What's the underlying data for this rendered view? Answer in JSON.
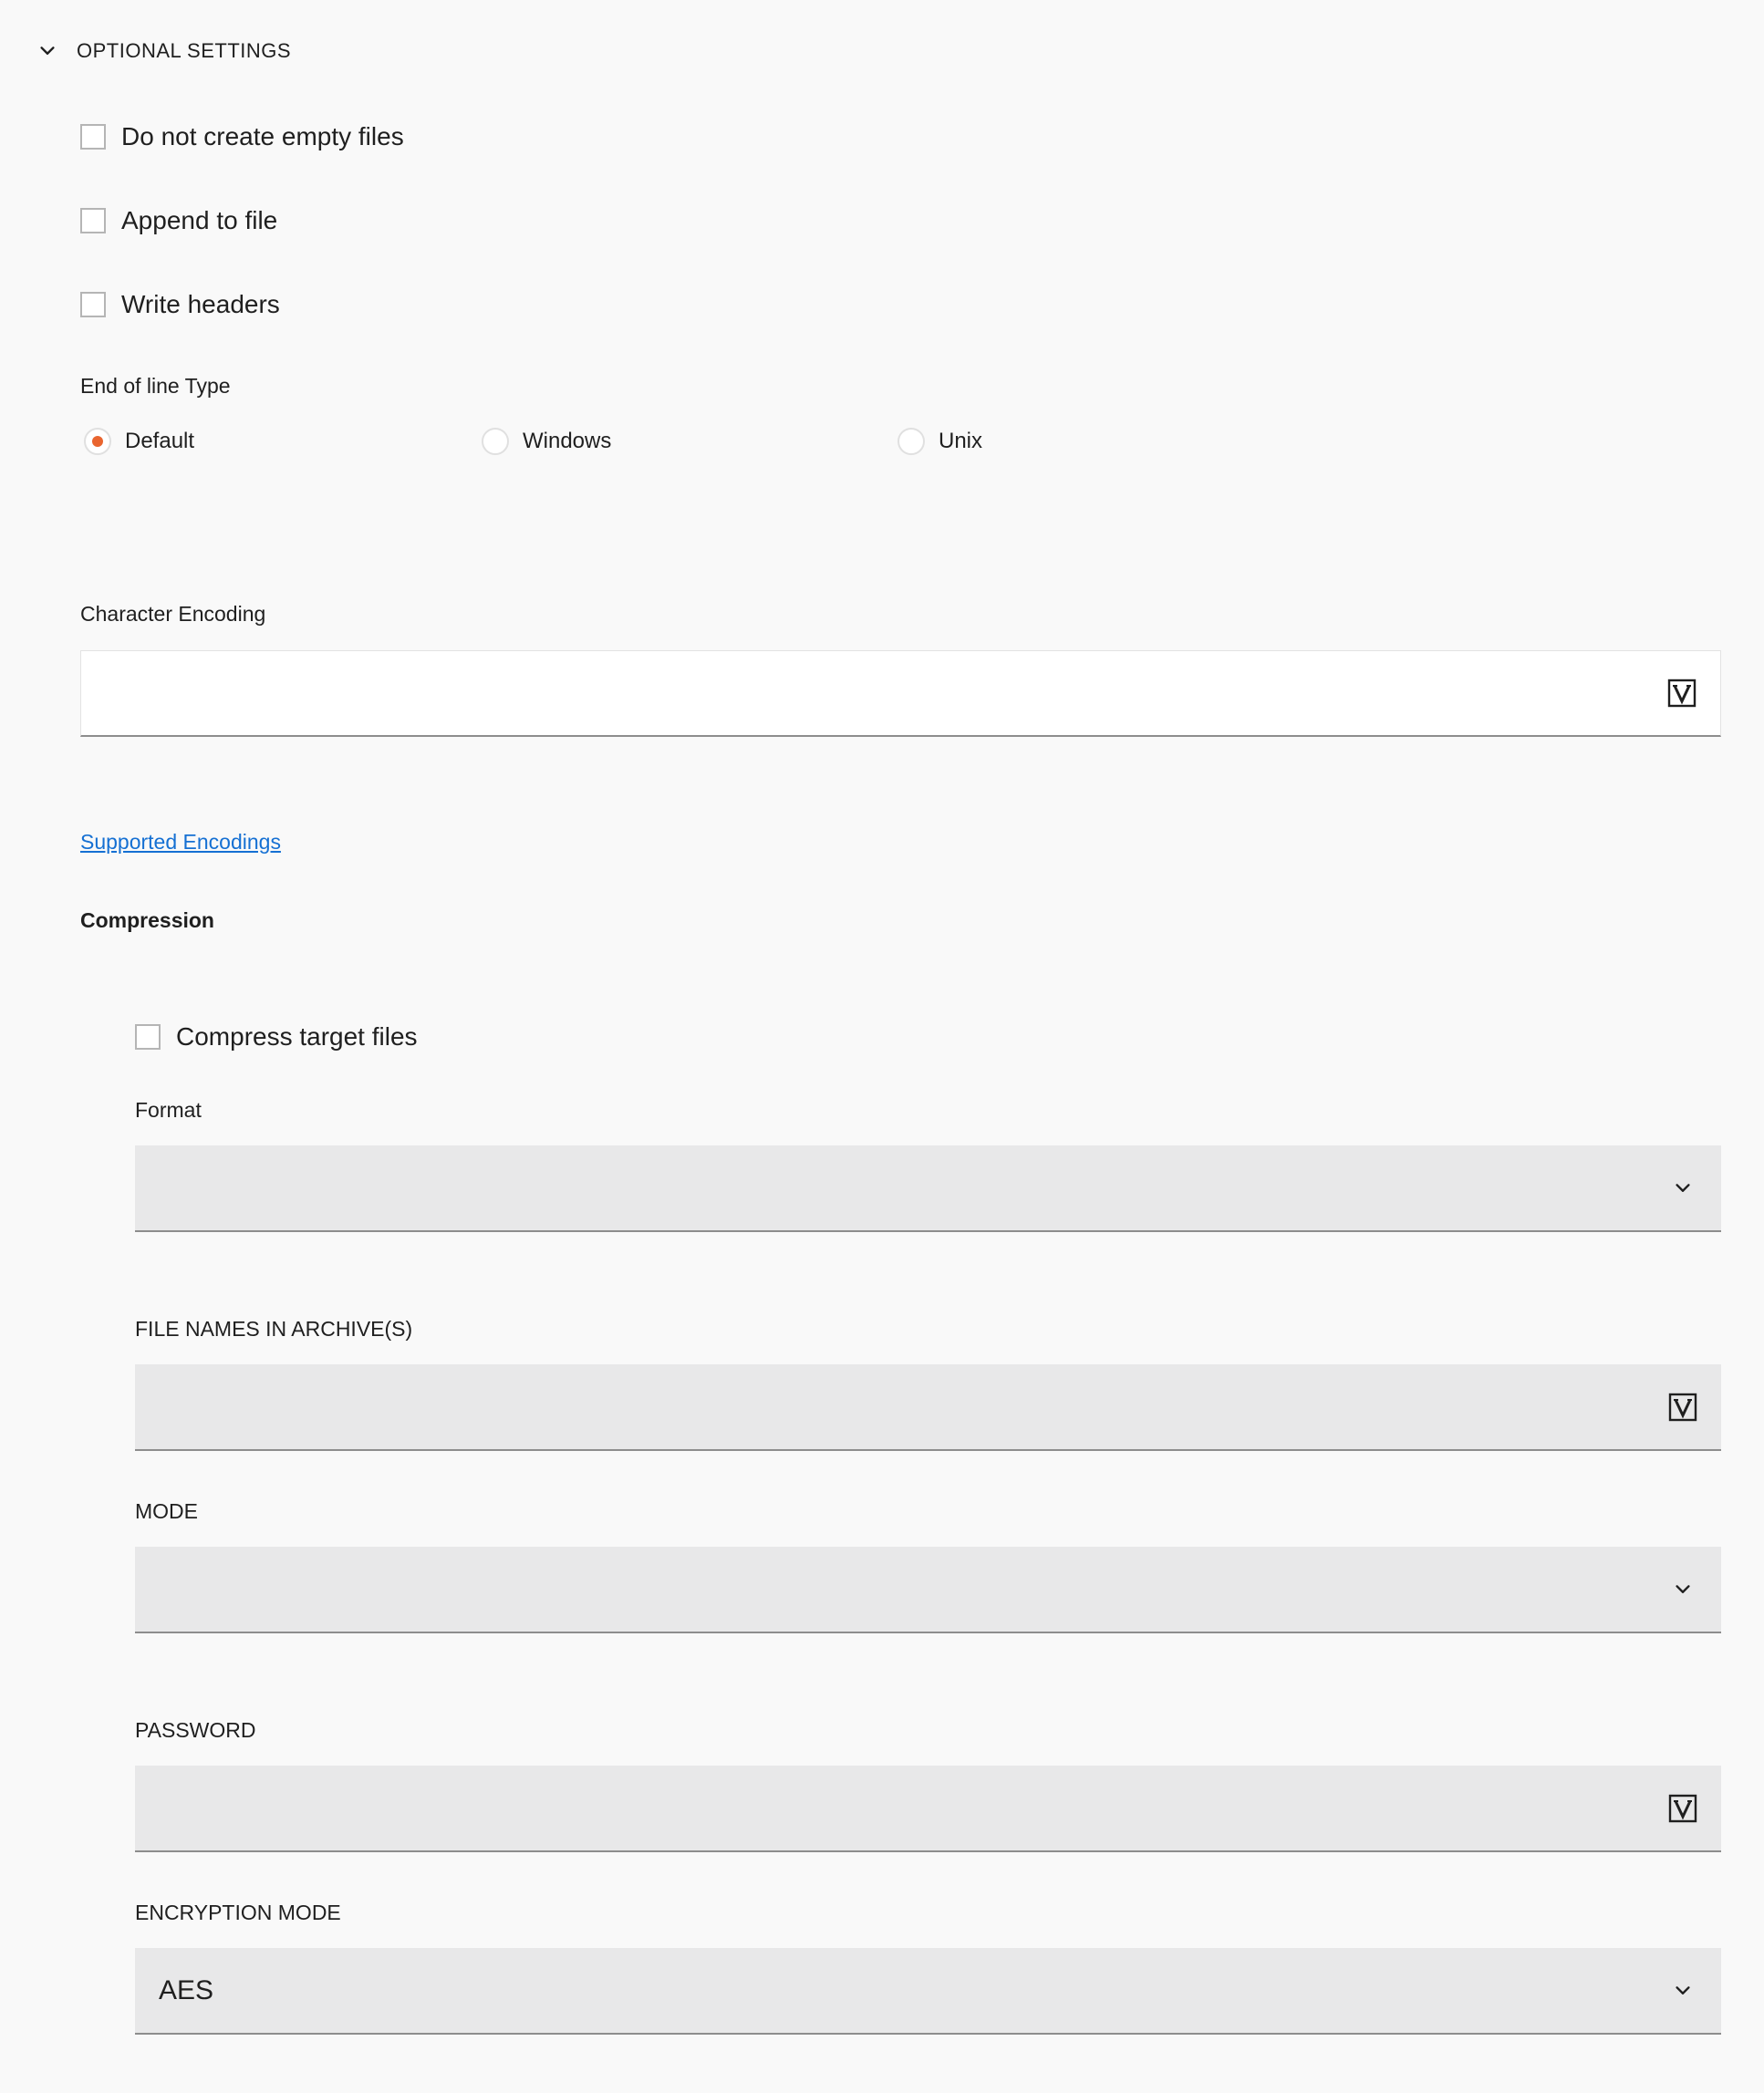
{
  "section": {
    "title": "OPTIONAL SETTINGS",
    "expanded_icon": "chevron-down-icon"
  },
  "checkboxes": {
    "no_empty_files": {
      "label": "Do not create empty files",
      "checked": false
    },
    "append_to_file": {
      "label": "Append to file",
      "checked": false
    },
    "write_headers": {
      "label": "Write headers",
      "checked": false
    }
  },
  "end_of_line": {
    "label": "End of line Type",
    "options": [
      {
        "label": "Default",
        "selected": true
      },
      {
        "label": "Windows",
        "selected": false
      },
      {
        "label": "Unix",
        "selected": false
      }
    ]
  },
  "character_encoding": {
    "label": "Character Encoding",
    "value": "",
    "icon": "variable-icon"
  },
  "supported_encodings_link": "Supported Encodings",
  "compression": {
    "heading": "Compression",
    "compress_target_files": {
      "label": "Compress target files",
      "checked": false
    },
    "format": {
      "label": "Format",
      "value": ""
    },
    "file_names_in_archive": {
      "label": "FILE NAMES IN ARCHIVE(S)",
      "value": ""
    },
    "mode": {
      "label": "MODE",
      "value": ""
    },
    "password": {
      "label": "PASSWORD",
      "value": ""
    },
    "encryption_mode": {
      "label": "ENCRYPTION MODE",
      "value": "AES"
    }
  },
  "colors": {
    "accent": "#e9652f",
    "link": "#1570d3",
    "background": "#f9f9f9",
    "input_grey": "#e8e8e9"
  }
}
